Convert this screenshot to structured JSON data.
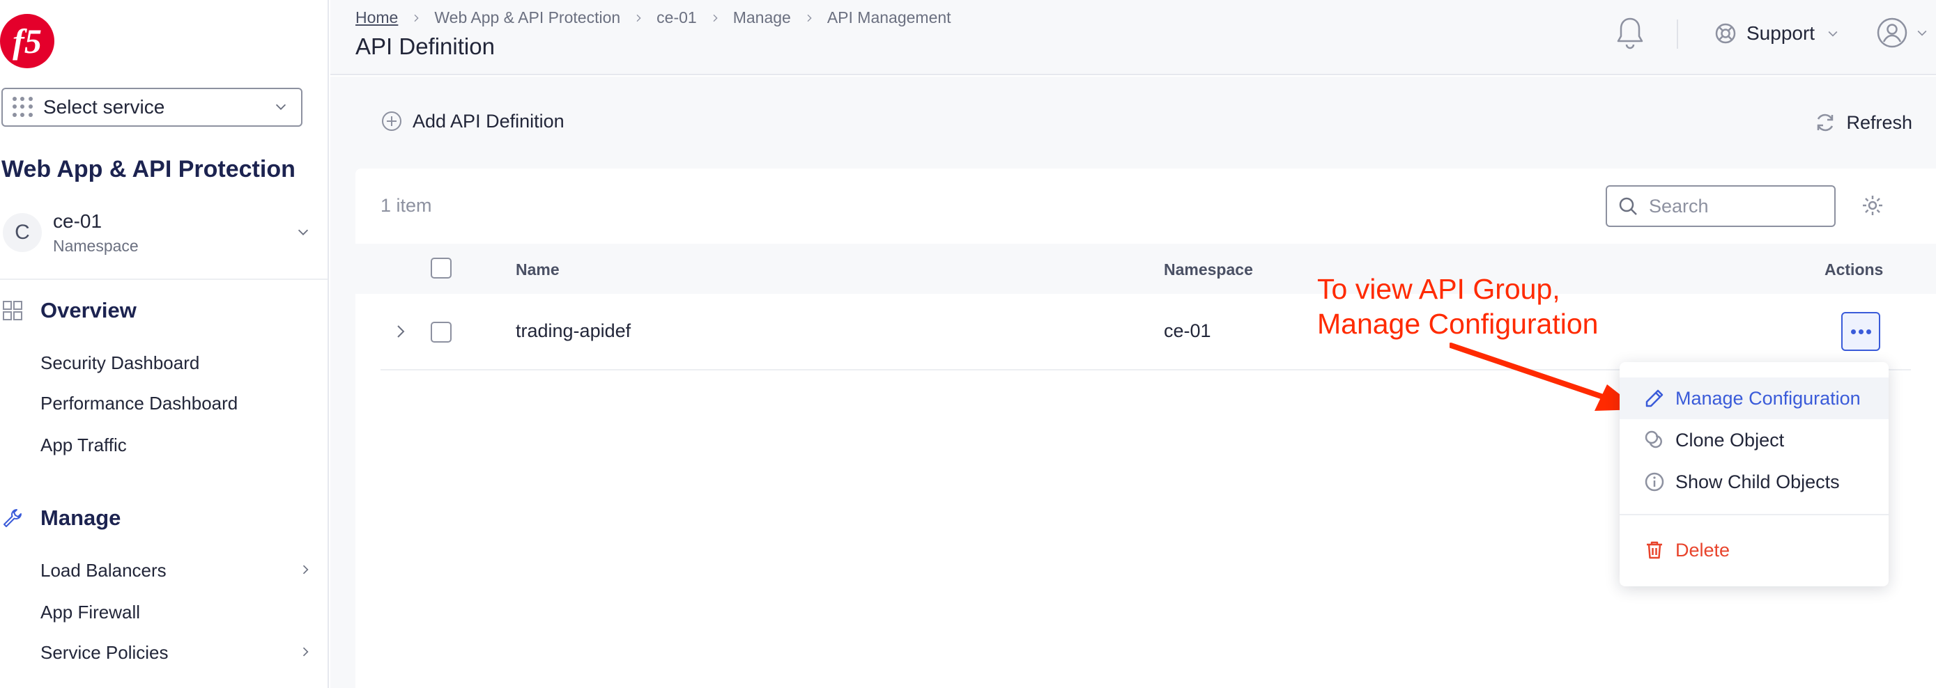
{
  "sidebar": {
    "logo_text": "f5",
    "service_select": "Select service",
    "workspace_title": "Web App & API Protection",
    "namespace": {
      "avatar": "C",
      "name": "ce-01",
      "label": "Namespace"
    },
    "sections": [
      {
        "title": "Overview",
        "icon": "grid-icon",
        "items": [
          {
            "label": "Security Dashboard"
          },
          {
            "label": "Performance Dashboard"
          },
          {
            "label": "App Traffic"
          }
        ]
      },
      {
        "title": "Manage",
        "icon": "wrench-icon",
        "items": [
          {
            "label": "Load Balancers",
            "has_submenu": true
          },
          {
            "label": "App Firewall"
          },
          {
            "label": "Service Policies",
            "has_submenu": true
          }
        ]
      }
    ]
  },
  "header": {
    "breadcrumb": [
      "Home",
      "Web App & API Protection",
      "ce-01",
      "Manage",
      "API Management"
    ],
    "title": "API Definition",
    "support_label": "Support"
  },
  "toolbar": {
    "add_label": "Add API Definition",
    "refresh_label": "Refresh"
  },
  "table": {
    "count_label": "1 item",
    "search_placeholder": "Search",
    "columns": {
      "name": "Name",
      "namespace": "Namespace",
      "actions": "Actions"
    },
    "rows": [
      {
        "name": "trading-apidef",
        "namespace": "ce-01"
      }
    ]
  },
  "annotation": {
    "line1": "To view API Group,",
    "line2": "Manage Configuration",
    "color": "#ff2a00"
  },
  "menu": {
    "items": [
      {
        "label": "Manage Configuration",
        "icon": "pencil-icon",
        "active": true
      },
      {
        "label": "Clone Object",
        "icon": "clone-icon"
      },
      {
        "label": "Show Child Objects",
        "icon": "info-icon"
      },
      {
        "label": "Delete",
        "icon": "trash-icon",
        "danger": true
      }
    ]
  },
  "colors": {
    "accent": "#3a5bd9",
    "danger": "#e8442c",
    "brand": "#e4002b"
  }
}
